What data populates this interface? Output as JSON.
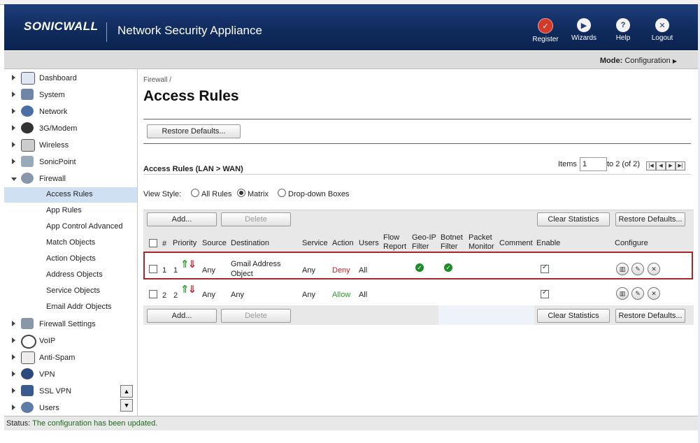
{
  "header": {
    "logo": "SONICWALL",
    "product": "Network Security Appliance",
    "buttons": [
      {
        "label": "Register",
        "icon": "register-icon"
      },
      {
        "label": "Wizards",
        "icon": "wizards-icon"
      },
      {
        "label": "Help",
        "icon": "help-icon"
      },
      {
        "label": "Logout",
        "icon": "logout-icon"
      }
    ]
  },
  "modebar": {
    "mode_label": "Mode:",
    "mode_value": "Configuration"
  },
  "nav": {
    "items": [
      {
        "label": "Dashboard",
        "icon": "dashboard-icon"
      },
      {
        "label": "System",
        "icon": "system-icon"
      },
      {
        "label": "Network",
        "icon": "network-icon"
      },
      {
        "label": "3G/Modem",
        "icon": "modem-icon"
      },
      {
        "label": "Wireless",
        "icon": "wireless-icon"
      },
      {
        "label": "SonicPoint",
        "icon": "sonicpoint-icon"
      },
      {
        "label": "Firewall",
        "icon": "firewall-icon"
      }
    ],
    "firewall_sub": [
      "Access Rules",
      "App Rules",
      "App Control Advanced",
      "Match Objects",
      "Action Objects",
      "Address Objects",
      "Service Objects",
      "Email Addr Objects"
    ],
    "more_items": [
      {
        "label": "Firewall Settings",
        "icon": "firewall-settings-icon"
      },
      {
        "label": "VoIP",
        "icon": "voip-icon"
      },
      {
        "label": "Anti-Spam",
        "icon": "antispam-icon"
      },
      {
        "label": "VPN",
        "icon": "vpn-icon"
      },
      {
        "label": "SSL VPN",
        "icon": "sslvpn-icon"
      },
      {
        "label": "Users",
        "icon": "users-icon"
      }
    ]
  },
  "content": {
    "breadcrumb": "Firewall /",
    "title": "Access Rules",
    "restore_defaults_top": "Restore Defaults...",
    "section_title": "Access Rules (LAN > WAN)",
    "items_label": "Items",
    "items_value": "1",
    "items_range": "to 2 (of 2)",
    "view_style_label": "View Style:",
    "view_options": [
      "All Rules",
      "Matrix",
      "Drop-down Boxes"
    ],
    "view_selected": "Matrix",
    "toolbar": {
      "add": "Add...",
      "delete": "Delete",
      "clear_stats": "Clear Statistics",
      "restore_defaults": "Restore Defaults..."
    },
    "columns": {
      "num": "#",
      "priority": "Priority",
      "source": "Source",
      "destination": "Destination",
      "service": "Service",
      "action": "Action",
      "users": "Users",
      "flow1": "Flow",
      "flow2": "Report",
      "geo1": "Geo-IP",
      "geo2": "Filter",
      "botnet1": "Botnet",
      "botnet2": "Filter",
      "packet1": "Packet",
      "packet2": "Monitor",
      "comment": "Comment",
      "enable": "Enable",
      "configure": "Configure"
    },
    "rows": [
      {
        "num": "1",
        "priority": "1",
        "source": "Any",
        "destination1": "Gmail Address",
        "destination2": "Object",
        "service": "Any",
        "action": "Deny",
        "users": "All",
        "geo_ip": true,
        "botnet": true,
        "enabled": true
      },
      {
        "num": "2",
        "priority": "2",
        "source": "Any",
        "destination1": "Any",
        "destination2": "",
        "service": "Any",
        "action": "Allow",
        "users": "All",
        "geo_ip": false,
        "botnet": false,
        "enabled": true
      }
    ]
  },
  "status": {
    "label": "Status:",
    "message": "The configuration has been updated."
  }
}
